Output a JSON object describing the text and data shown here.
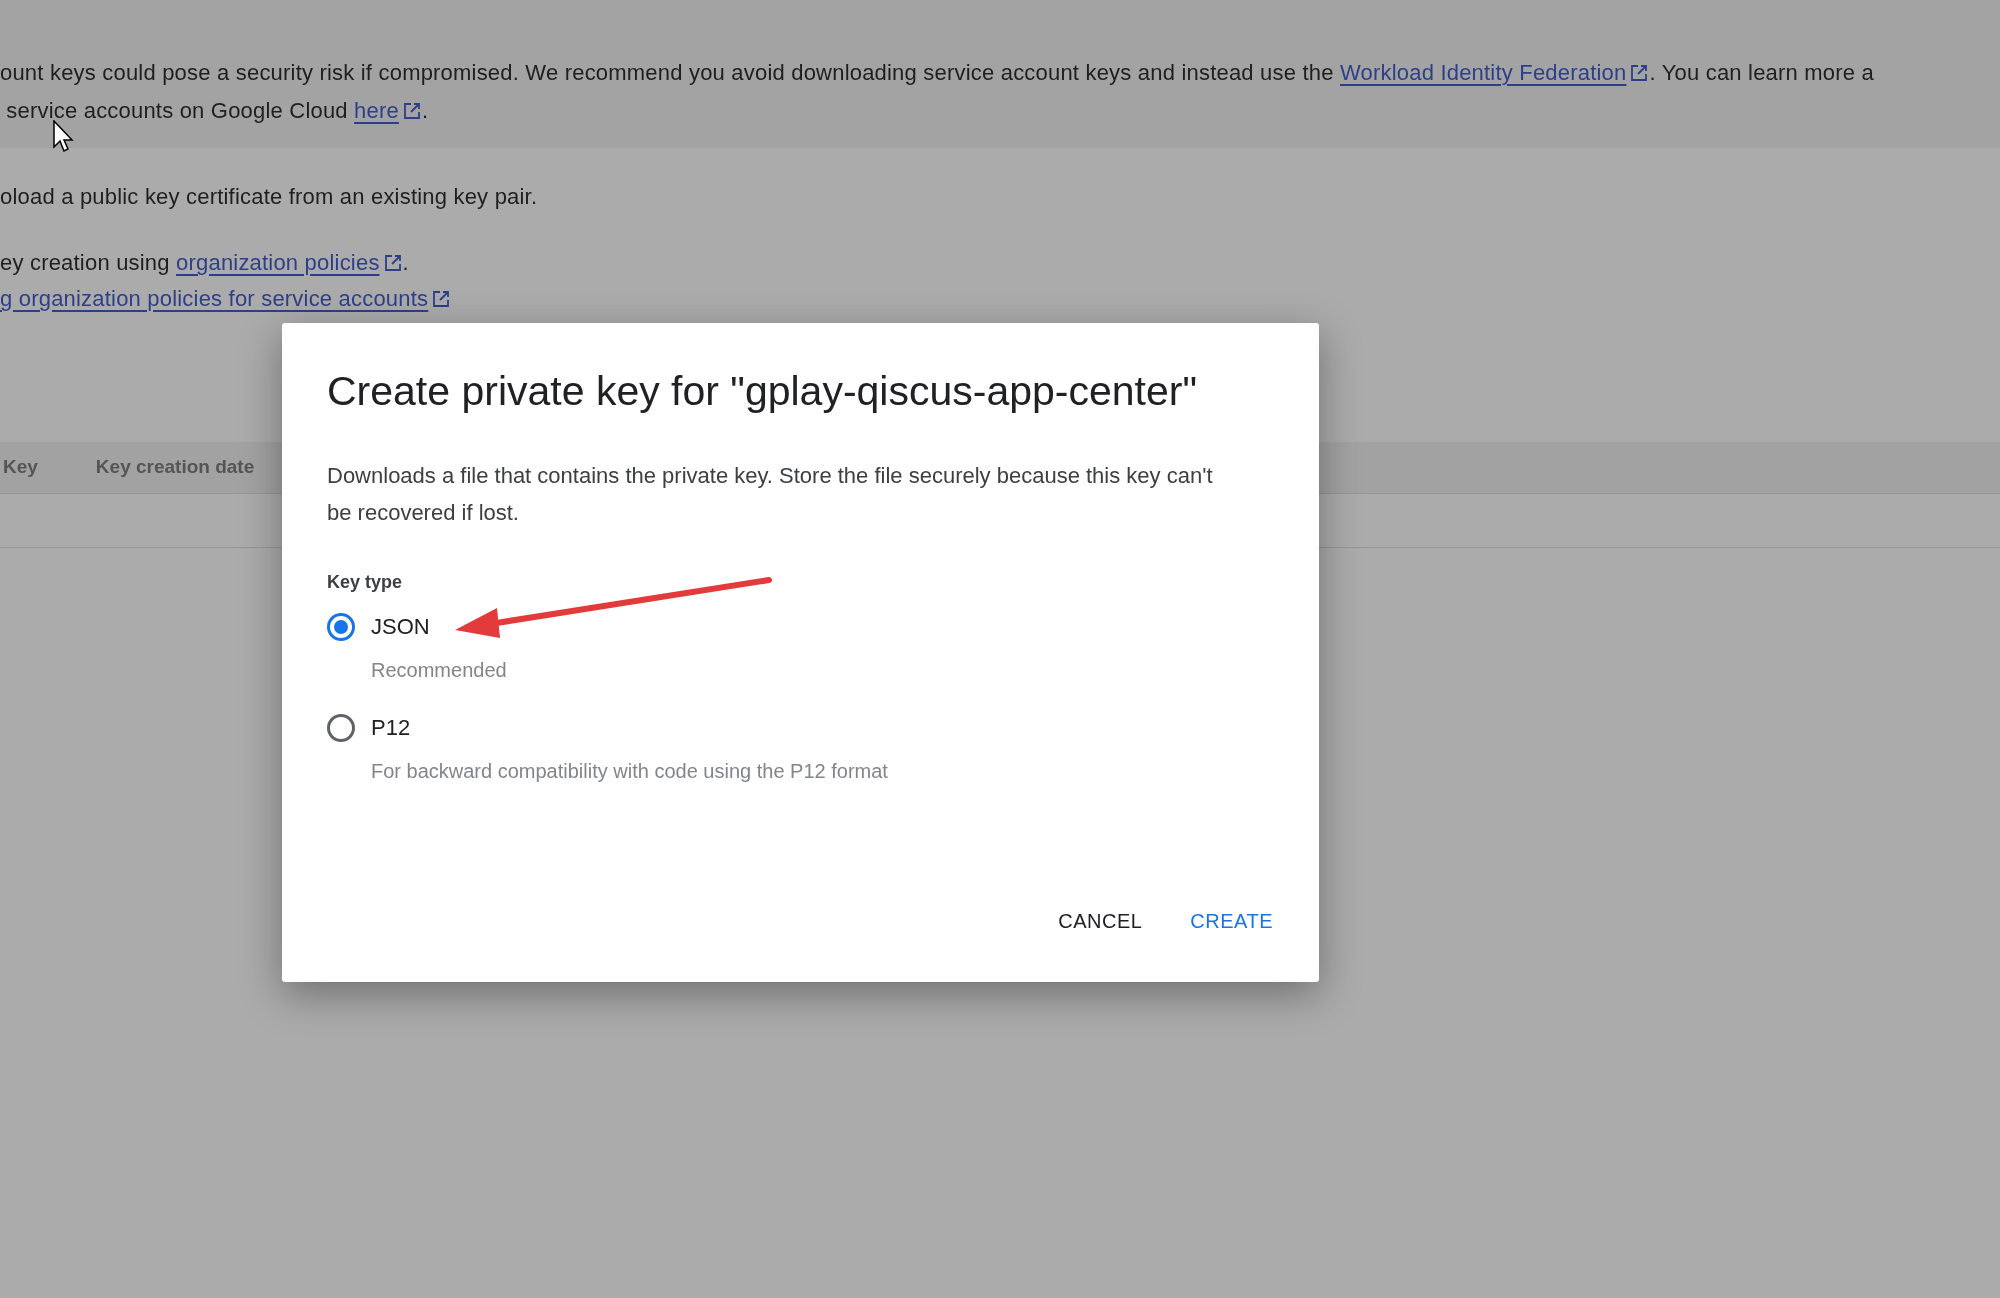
{
  "banner": {
    "lines": [
      [
        {
          "kind": "text",
          "text": "ount keys could pose a security risk if compromised. We recommend you avoid downloading service account keys and instead use the "
        },
        {
          "kind": "link",
          "text": "Workload Identity Federation"
        },
        {
          "kind": "text",
          "text": ". You can learn more a"
        }
      ],
      [
        {
          "kind": "text",
          "text": " service accounts on Google Cloud "
        },
        {
          "kind": "link",
          "text": "here"
        },
        {
          "kind": "text",
          "text": "."
        }
      ]
    ]
  },
  "page_lines": [
    [
      {
        "kind": "text",
        "text": "oload a public key certificate from an existing key pair."
      }
    ],
    [
      {
        "kind": "text",
        "text": "ey creation using "
      },
      {
        "kind": "link",
        "text": "organization policies"
      },
      {
        "kind": "text",
        "text": "."
      }
    ],
    [
      {
        "kind": "link",
        "text": "g organization policies for service accounts"
      }
    ]
  ],
  "table": {
    "columns": [
      "Key",
      "Key creation date"
    ]
  },
  "dialog": {
    "title": "Create private key for \"gplay-qiscus-app-center\"",
    "description": "Downloads a file that contains the private key. Store the file securely because this key can't be recovered if lost.",
    "key_type_label": "Key type",
    "options": [
      {
        "label": "JSON",
        "hint": "Recommended",
        "selected": true
      },
      {
        "label": "P12",
        "hint": "For backward compatibility with code using the P12 format",
        "selected": false
      }
    ],
    "buttons": [
      {
        "label": "CANCEL",
        "kind": "secondary"
      },
      {
        "label": "CREATE",
        "kind": "primary"
      }
    ]
  }
}
